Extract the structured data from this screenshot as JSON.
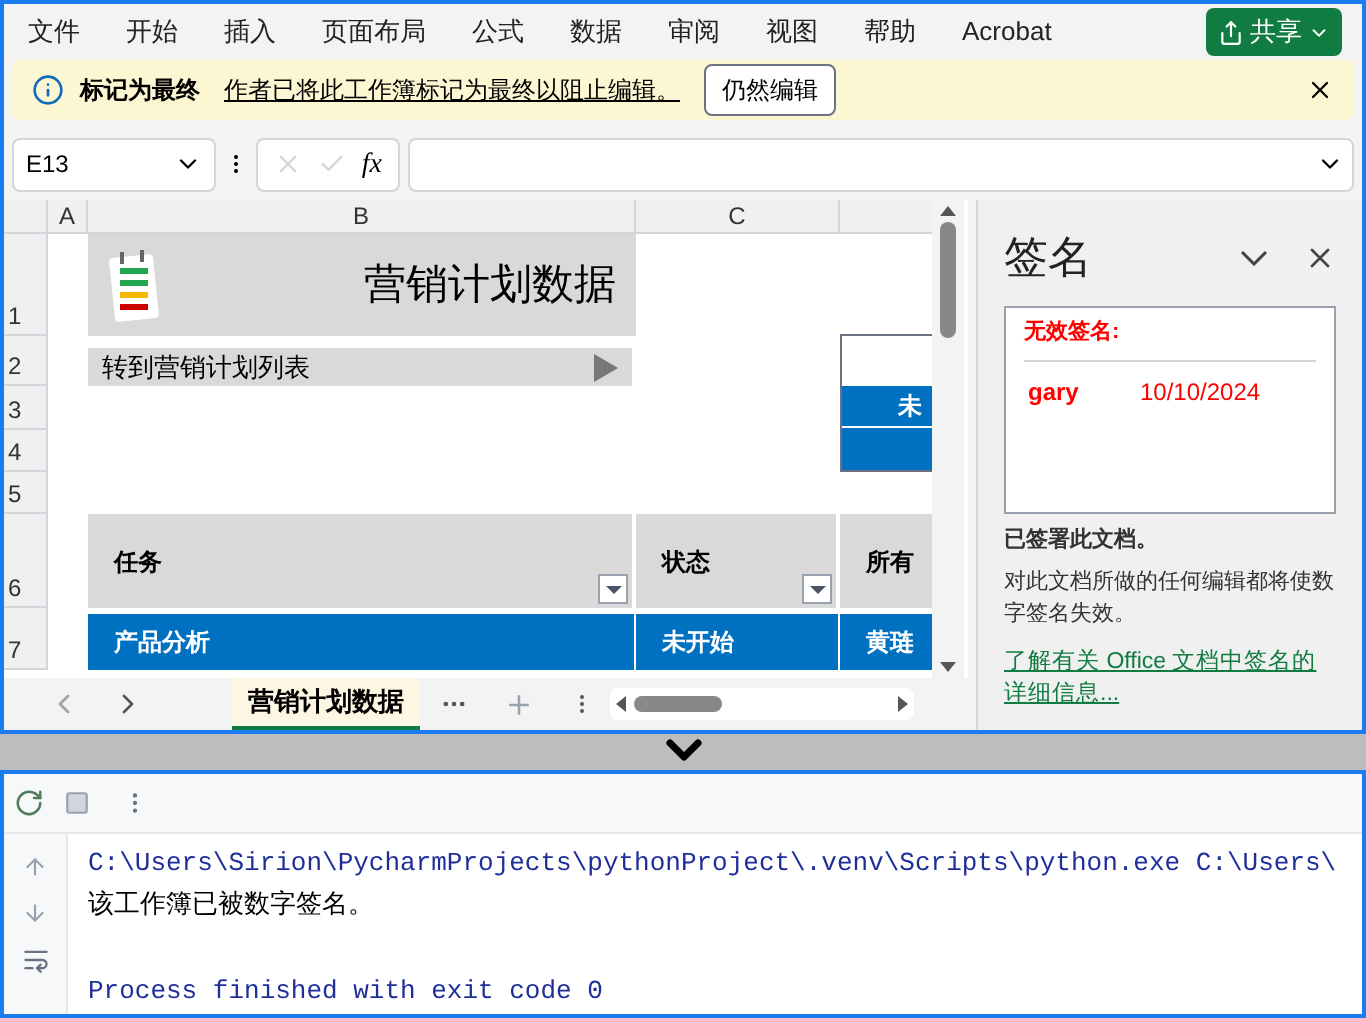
{
  "menu_tabs": [
    "文件",
    "开始",
    "插入",
    "页面布局",
    "公式",
    "数据",
    "审阅",
    "视图",
    "帮助",
    "Acrobat"
  ],
  "share_button": "共享",
  "info_bar": {
    "title": "标记为最终",
    "message": "作者已将此工作簿标记为最终以阻止编辑。",
    "button": "仍然编辑"
  },
  "formula_bar": {
    "name_box": "E13",
    "function_label": "fx"
  },
  "sheet": {
    "column_headers": [
      "A",
      "B",
      "C"
    ],
    "row_headers": [
      "1",
      "2",
      "3",
      "4",
      "5",
      "6",
      "7"
    ],
    "title": "营销计划数据",
    "link": "转到营销计划列表",
    "side_box_text": "未",
    "table": {
      "columns": [
        "任务",
        "状态",
        "所有"
      ],
      "rows": [
        [
          "产品分析",
          "未开始",
          "黄琏"
        ]
      ]
    }
  },
  "sheet_tabs": [
    {
      "label": "营销计划数据",
      "selected": true
    }
  ],
  "signature_pane": {
    "title": "签名",
    "invalid_label": "无效签名:",
    "signatures": [
      {
        "signer": "gary",
        "date": "10/10/2024"
      }
    ],
    "signed_note": "已签署此文档。",
    "warning": "对此文档所做的任何编辑都将使数字签名失效。",
    "link": "了解有关 Office 文档中签名的详细信息..."
  },
  "console": {
    "lines": [
      {
        "kind": "command",
        "text": "C:\\Users\\Sirion\\PycharmProjects\\pythonProject\\.venv\\Scripts\\python.exe C:\\Users\\"
      },
      {
        "kind": "output",
        "text": "该工作簿已被数字签名。"
      },
      {
        "kind": "status",
        "text": "Process finished with exit code 0"
      }
    ]
  }
}
